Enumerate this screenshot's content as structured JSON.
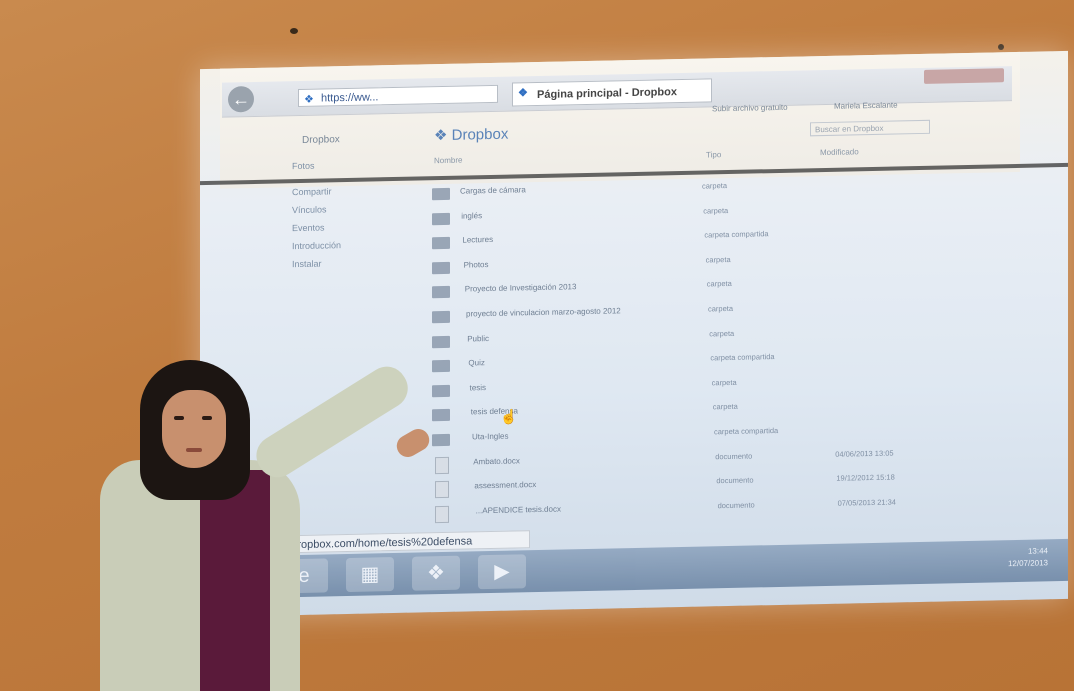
{
  "browser": {
    "address": "https://ww...",
    "tab_title": "Página principal - Dropbox",
    "status_url": "www.dropbox.com/home/tesis%20defensa"
  },
  "dropbox": {
    "sidebar_brand": "Dropbox",
    "logo": "Dropbox",
    "upload_link": "Subir archivo gratuito",
    "user": "Mariela Escalante",
    "search_placeholder": "Buscar en Dropbox",
    "columns": {
      "name": "Nombre",
      "type": "Tipo",
      "modified": "Modificado"
    },
    "sidebar": [
      "Fotos",
      "Compartir",
      "Vínculos",
      "Eventos",
      "Introducción",
      "Instalar"
    ],
    "files": [
      {
        "name": "Cargas de cámara",
        "type": "carpeta",
        "date": "",
        "kind": "folder"
      },
      {
        "name": "inglés",
        "type": "carpeta",
        "date": "",
        "kind": "folder"
      },
      {
        "name": "Lectures",
        "type": "carpeta compartida",
        "date": "",
        "kind": "folder"
      },
      {
        "name": "Photos",
        "type": "carpeta",
        "date": "",
        "kind": "folder"
      },
      {
        "name": "Proyecto de Investigación 2013",
        "type": "carpeta",
        "date": "",
        "kind": "folder"
      },
      {
        "name": "proyecto de vinculacion marzo-agosto 2012",
        "type": "carpeta",
        "date": "",
        "kind": "folder"
      },
      {
        "name": "Public",
        "type": "carpeta",
        "date": "",
        "kind": "folder"
      },
      {
        "name": "Quiz",
        "type": "carpeta compartida",
        "date": "",
        "kind": "folder"
      },
      {
        "name": "tesis",
        "type": "carpeta",
        "date": "",
        "kind": "folder"
      },
      {
        "name": "tesis defensa",
        "type": "carpeta",
        "date": "",
        "kind": "folder"
      },
      {
        "name": "Uta-Ingles",
        "type": "carpeta compartida",
        "date": "",
        "kind": "folder"
      },
      {
        "name": "Ambato.docx",
        "type": "documento",
        "date": "04/06/2013 13:05",
        "kind": "doc"
      },
      {
        "name": "assessment.docx",
        "type": "documento",
        "date": "19/12/2012 15:18",
        "kind": "doc"
      },
      {
        "name": "...APENDICE tesis.docx",
        "type": "documento",
        "date": "07/05/2013 21:34",
        "kind": "doc"
      }
    ]
  },
  "taskbar": {
    "clock_time": "13:44",
    "clock_date": "12/07/2013"
  },
  "colors": {
    "wall": "#c07c3f",
    "projection": "#e4ecf4",
    "folder": "#7f8ea2",
    "jacket": "#c9cdb8"
  }
}
